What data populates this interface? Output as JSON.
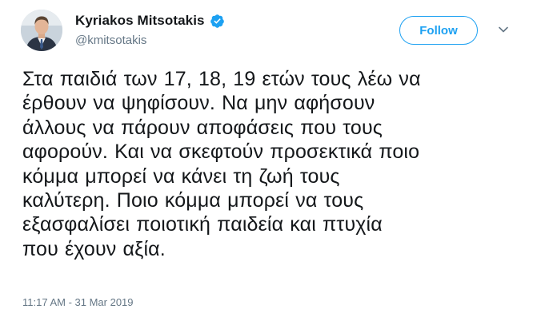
{
  "author": {
    "display_name": "Kyriakos Mitsotakis",
    "handle": "@kmitsotakis",
    "verified": true
  },
  "actions": {
    "follow_label": "Follow"
  },
  "tweet": {
    "lines": [
      "Στα παιδιά των 17, 18, 19 ετών τους λέω να",
      "έρθουν να ψηφίσουν. Να μην αφήσουν",
      "άλλους να πάρουν αποφάσεις που τους",
      "αφορούν. Και να σκεφτούν προσεκτικά ποιο",
      "κόμμα μπορεί να κάνει τη ζωή τους",
      "καλύτερη. Ποιο κόμμα μπορεί να τους",
      "εξασφαλίσει ποιοτική παιδεία και πτυχία",
      "που έχουν αξία."
    ],
    "timestamp": "11:17 AM - 31 Mar 2019"
  },
  "colors": {
    "accent": "#1da1f2",
    "text": "#14171a",
    "secondary_text": "#657786"
  },
  "icons": {
    "verified": "verified-badge-icon",
    "caret": "chevron-down-icon"
  }
}
